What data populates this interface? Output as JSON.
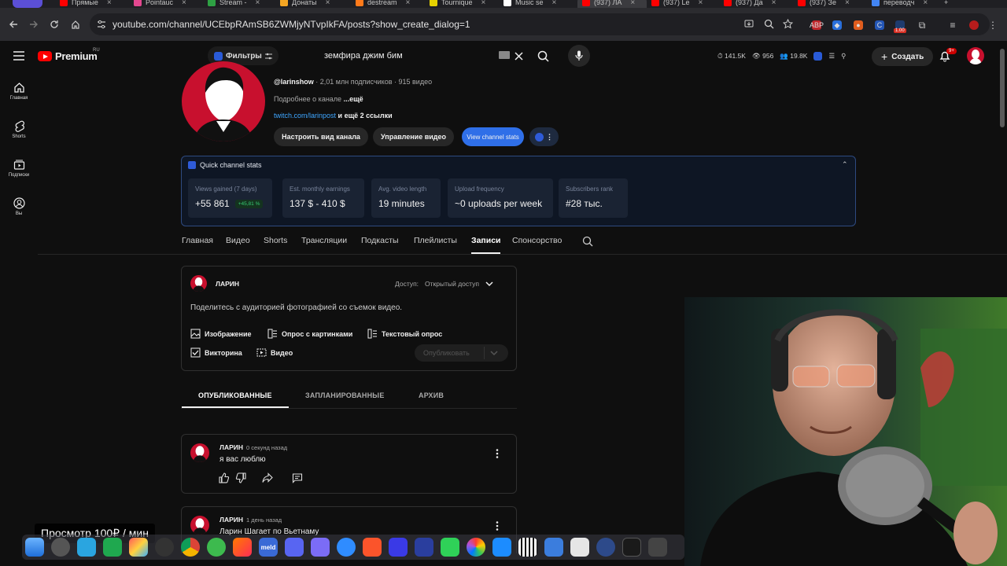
{
  "browser": {
    "tabs": [
      {
        "label": "Прямые",
        "color": "#ff0000"
      },
      {
        "label": "Pointauc",
        "color": "#e3478f"
      },
      {
        "label": "Stream -",
        "color": "#2ea043"
      },
      {
        "label": "Донаты",
        "color": "#f5a623"
      },
      {
        "label": "destream",
        "color": "#ff7a1a"
      },
      {
        "label": "Tournique",
        "color": "#e6d200"
      },
      {
        "label": "Music se",
        "color": "#ffffff"
      },
      {
        "label": "(937) ЛА",
        "color": "#ff0000"
      },
      {
        "label": "(937) Le",
        "color": "#ff0000"
      },
      {
        "label": "(937) Да",
        "color": "#ff0000"
      },
      {
        "label": "(937) Зе",
        "color": "#ff0000"
      },
      {
        "label": "переводч",
        "color": "#4285f4"
      }
    ],
    "url": "youtube.com/channel/UCEbpRAmSB6ZWMjyNTvpIkFA/posts?show_create_dialog=1",
    "ext_badge": "1.00"
  },
  "header": {
    "logo_text": "Premium",
    "logo_region": "RU",
    "filters_label": "Фильтры",
    "search_value": "земфира джим бим",
    "stats": {
      "views": "141.5K",
      "watching": "956",
      "subs": "19.8K"
    },
    "create_label": "Создать",
    "notif_count": "9+"
  },
  "leftnav": [
    {
      "label": "Главная",
      "icon": "home-icon"
    },
    {
      "label": "Shorts",
      "icon": "shorts-icon"
    },
    {
      "label": "Подписки",
      "icon": "subscriptions-icon"
    },
    {
      "label": "Вы",
      "icon": "you-icon"
    }
  ],
  "channel": {
    "handle": "@larinshow",
    "meta": " · 2,01 млн подписчиков · 915 видео",
    "about_prefix": "Подробнее о канале ",
    "about_more": "...ещё",
    "link": "twitch.com/larinpost",
    "link_more": " и ещё 2 ссылки",
    "btn_customize": "Настроить вид канала",
    "btn_manage": "Управление видео",
    "btn_stats": "View channel stats"
  },
  "quick_stats": {
    "title": "Quick channel stats",
    "cards": [
      {
        "label": "Views gained (7 days)",
        "value": "+55 861",
        "badge": "+45,81 %"
      },
      {
        "label": "Est. monthly earnings",
        "value": "137 $ - 410 $"
      },
      {
        "label": "Avg. video length",
        "value": "19 minutes"
      },
      {
        "label": "Upload frequency",
        "value": "~0 uploads per week"
      },
      {
        "label": "Subscribers rank",
        "value": "#28 тыс."
      }
    ]
  },
  "channel_tabs": [
    "Главная",
    "Видео",
    "Shorts",
    "Трансляции",
    "Подкасты",
    "Плейлисты",
    "Записи",
    "Спонсорство"
  ],
  "composer": {
    "author": "ЛАРИН",
    "access_label": "Доступ:",
    "access_value": "Открытый доступ",
    "prompt": "Поделитесь с аудиторией фотографией со съемок видео.",
    "opt_image": "Изображение",
    "opt_image_poll": "Опрос с картинками",
    "opt_text_poll": "Текстовый опрос",
    "opt_quiz": "Викторина",
    "opt_video": "Видео",
    "publish": "Опубликовать"
  },
  "post_tabs": [
    "ОПУБЛИКОВАННЫЕ",
    "ЗАПЛАНИРОВАННЫЕ",
    "АРХИВ"
  ],
  "posts": [
    {
      "author": "ЛАРИН",
      "time": "0 секунд назад",
      "text": "я вас люблю"
    },
    {
      "author": "ЛАРИН",
      "time": "1 день назад",
      "text": "Ларин Шагает по Вьетнаму"
    }
  ],
  "overlay": {
    "price": "Просмотр 100₽ / мин"
  }
}
